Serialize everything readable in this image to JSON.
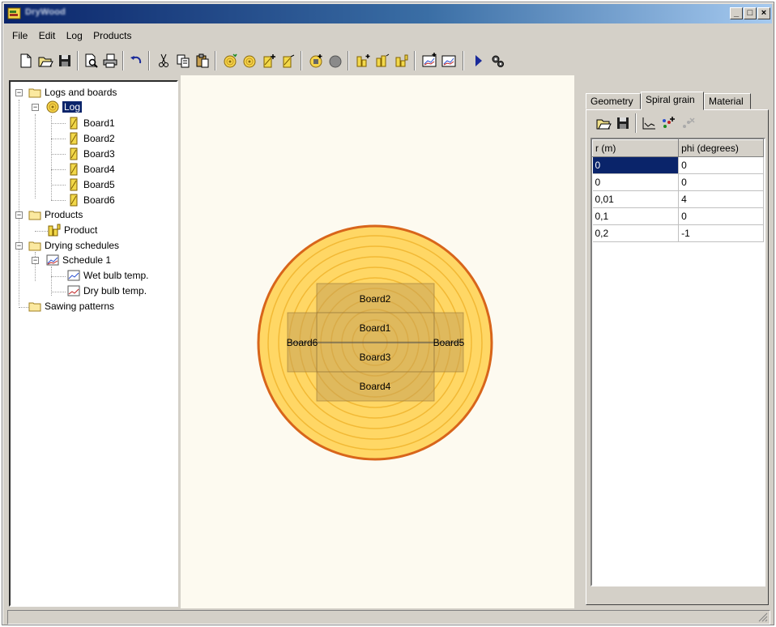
{
  "window": {
    "title": "DryWood"
  },
  "menu": [
    {
      "label": "File"
    },
    {
      "label": "Edit"
    },
    {
      "label": "Log"
    },
    {
      "label": "Products"
    }
  ],
  "toolbar": {
    "buttons": [
      "new-file-icon",
      "open-folder-icon",
      "save-icon",
      "print-preview-icon",
      "print-icon",
      "undo-icon",
      "cut-icon",
      "copy-icon",
      "paste-icon",
      "add-log-icon",
      "log-icon",
      "add-board-icon",
      "board-icon",
      "add-product-icon",
      "product-icon",
      "add-board-pattern-icon",
      "board-pattern-icon",
      "board-layout-icon",
      "add-schedule-icon",
      "schedule-icon",
      "run-icon",
      "settings-icon"
    ]
  },
  "tree": {
    "root": "Logs and boards",
    "log": "Log",
    "boards": [
      "Board1",
      "Board2",
      "Board3",
      "Board4",
      "Board5",
      "Board6"
    ],
    "products_folder": "Products",
    "product": "Product",
    "schedules_folder": "Drying schedules",
    "schedule": "Schedule 1",
    "wet": "Wet bulb temp.",
    "dry": "Dry bulb temp.",
    "sawing": "Sawing patterns"
  },
  "canvas": {
    "boards": [
      "Board1",
      "Board2",
      "Board3",
      "Board4",
      "Board5",
      "Board6"
    ],
    "colors": {
      "ring_fill": "#ffd765",
      "bark": "#d8651a",
      "rings": "#f2b935",
      "board": "#d4ac58"
    }
  },
  "panel": {
    "tabs": [
      "Geometry",
      "Spiral grain",
      "Material"
    ],
    "active_tab": "Spiral grain",
    "columns": [
      "r (m)",
      "phi (degrees)"
    ],
    "rows": [
      [
        "0",
        "0"
      ],
      [
        "0",
        "0"
      ],
      [
        "0,01",
        "4"
      ],
      [
        "0,1",
        "0"
      ],
      [
        "0,2",
        "-1"
      ]
    ]
  }
}
